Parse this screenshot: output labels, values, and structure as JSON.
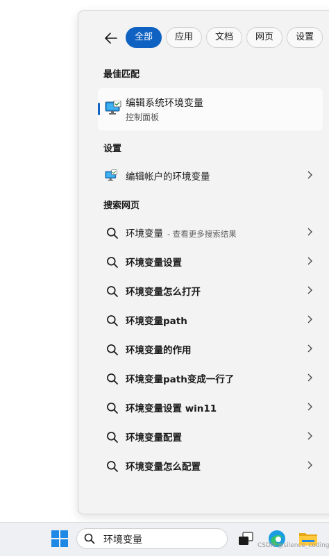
{
  "tabs": [
    {
      "label": "全部",
      "active": true
    },
    {
      "label": "应用"
    },
    {
      "label": "文档"
    },
    {
      "label": "网页"
    },
    {
      "label": "设置"
    }
  ],
  "sections": {
    "best_match": "最佳匹配",
    "settings": "设置",
    "web_search": "搜索网页"
  },
  "best_match": {
    "title": "编辑系统环境变量",
    "subtitle": "控制面板"
  },
  "settings_items": [
    {
      "label": "编辑帐户的环境变量",
      "icon": "monitor-settings-icon"
    }
  ],
  "web_results": [
    {
      "label": "环境变量",
      "sub": "- 查看更多搜索结果"
    },
    {
      "label": "环境变量设置"
    },
    {
      "label": "环境变量怎么打开"
    },
    {
      "label": "环境变量path"
    },
    {
      "label": "环境变量的作用"
    },
    {
      "label": "环境变量path变成一行了"
    },
    {
      "label": "环境变量设置 win11"
    },
    {
      "label": "环境变量配置"
    },
    {
      "label": "环境变量怎么配置"
    }
  ],
  "taskbar": {
    "search_value": "环境变量",
    "icons": [
      "windows-start-icon",
      "task-view-icon",
      "edge-browser-icon",
      "file-explorer-icon"
    ]
  },
  "watermark": "CSDN @silence_coding",
  "colors": {
    "accent": "#0f62c2",
    "panel_bg": "#f3f3f3",
    "taskbar_bg": "#eef0f3"
  }
}
